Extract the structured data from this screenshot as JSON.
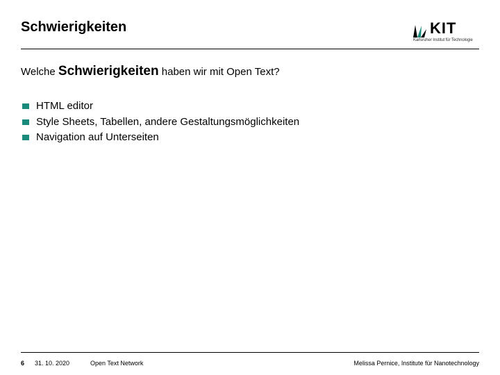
{
  "header": {
    "title": "Schwierigkeiten",
    "logo": {
      "text": "KIT",
      "subtitle": "Karlsruher Institut für Technologie"
    }
  },
  "body": {
    "subtitle_prefix": "Welche ",
    "subtitle_strong": "Schwierigkeiten",
    "subtitle_suffix": " haben wir mit Open Text?",
    "bullets": [
      "HTML editor",
      "Style Sheets, Tabellen, andere Gestaltungsmöglichkeiten",
      "Navigation auf Unterseiten"
    ]
  },
  "footer": {
    "page": "6",
    "date": "31. 10. 2020",
    "source": "Open Text Network",
    "author": "Melissa Pernice, Institute für Nanotechnology"
  }
}
